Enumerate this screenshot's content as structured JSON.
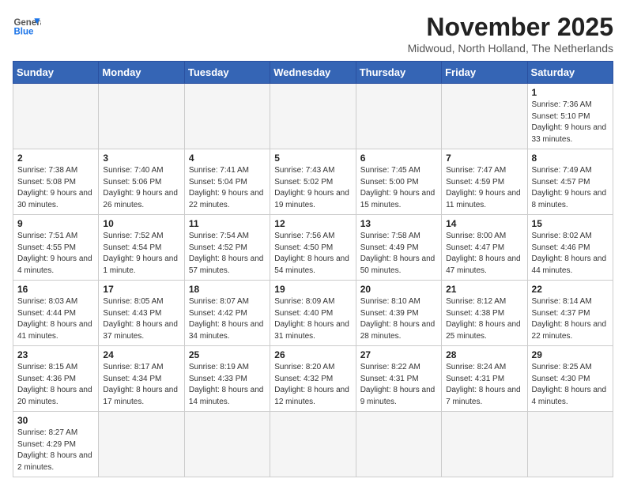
{
  "header": {
    "logo_general": "General",
    "logo_blue": "Blue",
    "month_title": "November 2025",
    "subtitle": "Midwoud, North Holland, The Netherlands"
  },
  "weekdays": [
    "Sunday",
    "Monday",
    "Tuesday",
    "Wednesday",
    "Thursday",
    "Friday",
    "Saturday"
  ],
  "weeks": [
    [
      {
        "day": "",
        "info": ""
      },
      {
        "day": "",
        "info": ""
      },
      {
        "day": "",
        "info": ""
      },
      {
        "day": "",
        "info": ""
      },
      {
        "day": "",
        "info": ""
      },
      {
        "day": "",
        "info": ""
      },
      {
        "day": "1",
        "info": "Sunrise: 7:36 AM\nSunset: 5:10 PM\nDaylight: 9 hours\nand 33 minutes."
      }
    ],
    [
      {
        "day": "2",
        "info": "Sunrise: 7:38 AM\nSunset: 5:08 PM\nDaylight: 9 hours\nand 30 minutes."
      },
      {
        "day": "3",
        "info": "Sunrise: 7:40 AM\nSunset: 5:06 PM\nDaylight: 9 hours\nand 26 minutes."
      },
      {
        "day": "4",
        "info": "Sunrise: 7:41 AM\nSunset: 5:04 PM\nDaylight: 9 hours\nand 22 minutes."
      },
      {
        "day": "5",
        "info": "Sunrise: 7:43 AM\nSunset: 5:02 PM\nDaylight: 9 hours\nand 19 minutes."
      },
      {
        "day": "6",
        "info": "Sunrise: 7:45 AM\nSunset: 5:00 PM\nDaylight: 9 hours\nand 15 minutes."
      },
      {
        "day": "7",
        "info": "Sunrise: 7:47 AM\nSunset: 4:59 PM\nDaylight: 9 hours\nand 11 minutes."
      },
      {
        "day": "8",
        "info": "Sunrise: 7:49 AM\nSunset: 4:57 PM\nDaylight: 9 hours\nand 8 minutes."
      }
    ],
    [
      {
        "day": "9",
        "info": "Sunrise: 7:51 AM\nSunset: 4:55 PM\nDaylight: 9 hours\nand 4 minutes."
      },
      {
        "day": "10",
        "info": "Sunrise: 7:52 AM\nSunset: 4:54 PM\nDaylight: 9 hours\nand 1 minute."
      },
      {
        "day": "11",
        "info": "Sunrise: 7:54 AM\nSunset: 4:52 PM\nDaylight: 8 hours\nand 57 minutes."
      },
      {
        "day": "12",
        "info": "Sunrise: 7:56 AM\nSunset: 4:50 PM\nDaylight: 8 hours\nand 54 minutes."
      },
      {
        "day": "13",
        "info": "Sunrise: 7:58 AM\nSunset: 4:49 PM\nDaylight: 8 hours\nand 50 minutes."
      },
      {
        "day": "14",
        "info": "Sunrise: 8:00 AM\nSunset: 4:47 PM\nDaylight: 8 hours\nand 47 minutes."
      },
      {
        "day": "15",
        "info": "Sunrise: 8:02 AM\nSunset: 4:46 PM\nDaylight: 8 hours\nand 44 minutes."
      }
    ],
    [
      {
        "day": "16",
        "info": "Sunrise: 8:03 AM\nSunset: 4:44 PM\nDaylight: 8 hours\nand 41 minutes."
      },
      {
        "day": "17",
        "info": "Sunrise: 8:05 AM\nSunset: 4:43 PM\nDaylight: 8 hours\nand 37 minutes."
      },
      {
        "day": "18",
        "info": "Sunrise: 8:07 AM\nSunset: 4:42 PM\nDaylight: 8 hours\nand 34 minutes."
      },
      {
        "day": "19",
        "info": "Sunrise: 8:09 AM\nSunset: 4:40 PM\nDaylight: 8 hours\nand 31 minutes."
      },
      {
        "day": "20",
        "info": "Sunrise: 8:10 AM\nSunset: 4:39 PM\nDaylight: 8 hours\nand 28 minutes."
      },
      {
        "day": "21",
        "info": "Sunrise: 8:12 AM\nSunset: 4:38 PM\nDaylight: 8 hours\nand 25 minutes."
      },
      {
        "day": "22",
        "info": "Sunrise: 8:14 AM\nSunset: 4:37 PM\nDaylight: 8 hours\nand 22 minutes."
      }
    ],
    [
      {
        "day": "23",
        "info": "Sunrise: 8:15 AM\nSunset: 4:36 PM\nDaylight: 8 hours\nand 20 minutes."
      },
      {
        "day": "24",
        "info": "Sunrise: 8:17 AM\nSunset: 4:34 PM\nDaylight: 8 hours\nand 17 minutes."
      },
      {
        "day": "25",
        "info": "Sunrise: 8:19 AM\nSunset: 4:33 PM\nDaylight: 8 hours\nand 14 minutes."
      },
      {
        "day": "26",
        "info": "Sunrise: 8:20 AM\nSunset: 4:32 PM\nDaylight: 8 hours\nand 12 minutes."
      },
      {
        "day": "27",
        "info": "Sunrise: 8:22 AM\nSunset: 4:31 PM\nDaylight: 8 hours\nand 9 minutes."
      },
      {
        "day": "28",
        "info": "Sunrise: 8:24 AM\nSunset: 4:31 PM\nDaylight: 8 hours\nand 7 minutes."
      },
      {
        "day": "29",
        "info": "Sunrise: 8:25 AM\nSunset: 4:30 PM\nDaylight: 8 hours\nand 4 minutes."
      }
    ],
    [
      {
        "day": "30",
        "info": "Sunrise: 8:27 AM\nSunset: 4:29 PM\nDaylight: 8 hours\nand 2 minutes."
      },
      {
        "day": "",
        "info": ""
      },
      {
        "day": "",
        "info": ""
      },
      {
        "day": "",
        "info": ""
      },
      {
        "day": "",
        "info": ""
      },
      {
        "day": "",
        "info": ""
      },
      {
        "day": "",
        "info": ""
      }
    ]
  ]
}
